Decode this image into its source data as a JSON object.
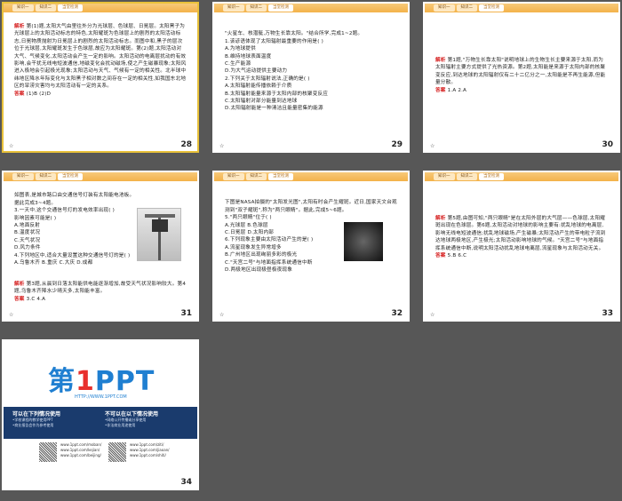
{
  "slides": [
    {
      "number": "28",
      "tabs": [
        "",
        "",
        " "
      ],
      "body_prefix": "解析",
      "body": "第(1)题,太阳大气由里往外分为光球层、色球层、日冕层。太阳黑子为光球层上的太阳活动标志的特色,太阳耀斑为色球层上的剧烈的太阳活动标志,日冕物质抛射为日冕层上的剧烈的太阳活动标志。而图中和,黑子的层次位于光球层,太阳耀斑发生于色球层,故应为太阳耀斑。第(2)题,太阳活动对大气、气候变化,太阳活动会产生一定的影响。太阳活动的电离层扰动的有效影响,会干扰无线电短波通信,地磁变化会扰动磁场,使之产生磁暴现象;太阳风进入极地会引起极光现象;太阳活动与天气、气候有一定的相关性。北半球中纬地区降水年际变化与太阳黑子相对数之间存在一定的相关性,如我国东北地区的旱涝灾害均与太阳活动有一定的关系。",
      "answer_label": "答案",
      "answer": "(1)B  (2)D"
    },
    {
      "number": "29",
      "tabs": [
        "",
        "",
        ""
      ],
      "body": "\"火星车、核潜艇,万物生长靠太阳。\"结合所学,完成1~2题。\n1.该谚语体现了太阳辐射最重要的作用是(      )\nA.为地球提供\nB.维持地球表面温度\nC.生产能源\nD.为大气运动提供主要动力\n2.下列关于太阳辐射说法,正确的是(      )\nA.太阳辐射能传播依赖于介质\nB.太阳辐射能量来源于太阳内部的核聚变反应\nC.太阳辐射对部分能量到达地球\nD.太阳辐射能是一种清洁且能量密集的能源"
    },
    {
      "number": "30",
      "tabs": [
        "",
        "",
        ""
      ],
      "body_prefix": "解析",
      "body": "第1题,\"万物生长靠太阳\"说明地球上的生物生长主要来源于太阳,而为太阳辐射主要方式提供了光热资源。第2题,太阳能是来源于太阳内部的核聚变反应,到达地球的太阳辐射仅有二十二亿分之一,太阳能是不再生能源,但能量分散。",
      "answer_label": "答案",
      "answer": "1.A  2.A"
    },
    {
      "number": "31",
      "tabs": [
        "",
        "",
        ""
      ],
      "body": "如图表,是城市路口由交通信号灯装有太阳能电池板。据此完成3~4题。\n3.一天中,这个交通信号灯的发电效率出现(      )\n影响因素可能是(      )\nA.地面反射\nB.温度状况\nC.天气状况\nD.风力条件\n4.下列地区中,适合大量设置这种交通信号灯的是(      )\nA.乌鲁木齐  B.重庆  C.大庆  D.成都",
      "analysis_prefix": "解析",
      "analysis": "第3题,从晨到日落太阳能供电能逐渐增加,故受天气状况影响较大。第4题,乌鲁木齐降水少晴天多,太阳能丰富。",
      "answer_label": "答案",
      "answer": "3.C  4.A"
    },
    {
      "number": "32",
      "tabs": [
        "",
        "",
        ""
      ],
      "body": "下图是NASA拍摄的\"太阳发光图\",太阳有时会产生耀斑。近日,国家天文台观测到\"双子耀斑\",称为\"两只眼睛\"。据此,完成5~6题。\n5.\"两只眼睛\"位于(      )\nA.光球层      B.色球层\nC.日冕层      D.太阳内部\n6.下列现象主要由太阳活动产生的是(      )\nA.流星现象发生异常增多\nB.广州地区出现绚丽多彩的极光\nC.\"天宫二号\"与地面指挥系统通信中断\nD.两极地区出现极昼极夜现象"
    },
    {
      "number": "33",
      "tabs": [
        "",
        "",
        ""
      ],
      "body_prefix": "解析",
      "body": "第5题,由图可知,\"两只眼睛\"是在太阳外层的大气层——色球层,太阳耀斑出现在色球层。第6题,太阳活动对地球的影响主要有:扰乱地球的电离层,影响无线电短波通信;扰乱地球磁场,产生磁暴;太阳活动产生的带电粒子流到达地球两极地区,产生极光;太阳活动影响地球的气候。\"天宫二号\"与地面指挥系统通信中断,说明太阳活动扰乱地球电离层,流星现象与太阳活动无关。",
      "answer_label": "答案",
      "answer": "5.B  6.C"
    },
    {
      "number": "34",
      "ad_brand_a": "第",
      "ad_brand_one": "1",
      "ad_brand_b": "PPT",
      "ad_url": "HTTP://WWW.1PPT.COM",
      "ad_can_title": "可以在下列情况使用",
      "ad_can_lines": [
        "•学校课程的教学使用PPT",
        "•商业报告会作为参考使用"
      ],
      "ad_cannot_title": "不可以在以下情况使用",
      "ad_cannot_lines": [
        "•网络公开传播或分享使用",
        "•非法商业用途使用"
      ],
      "ad_links": [
        "www.1ppt.com/moban/",
        "www.1ppt.com/kejian/",
        "www.1ppt.com/beijing/",
        "www.1ppt.com/ziti/",
        "www.1ppt.com/jiaoan/",
        "www.1ppt.com/shiti/"
      ]
    }
  ],
  "colors": {
    "workspace_bg": "#575757",
    "selection": "#e8c13a",
    "header_orange": "#f3b24a",
    "answer_red": "#d62020",
    "ad_blue": "#1f7fd1",
    "ad_band": "#1a3b6d"
  }
}
